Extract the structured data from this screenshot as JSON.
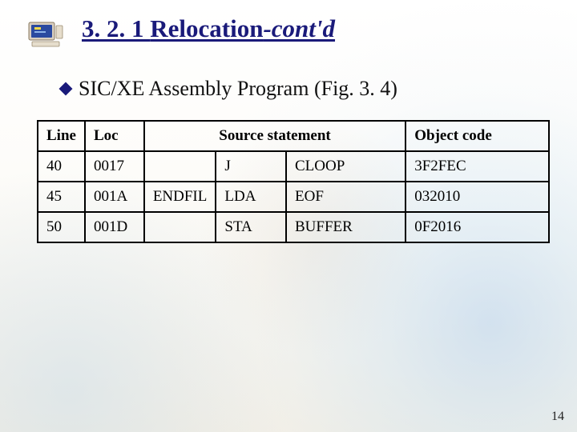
{
  "title": {
    "number": "3. 2. 1",
    "word": "Relocation",
    "contd": "-cont'd"
  },
  "bullet": {
    "text_a": "SIC/XE Assembly Program ",
    "fig": "(Fig. 3. 4)"
  },
  "table": {
    "headers": {
      "line": "Line",
      "loc": "Loc",
      "source": "Source statement",
      "object": "Object code"
    },
    "rows": [
      {
        "line": "40",
        "loc": "0017",
        "label": "",
        "op": "J",
        "arg": "CLOOP",
        "obj": "3F2FEC"
      },
      {
        "line": "45",
        "loc": "001A",
        "label": "ENDFIL",
        "op": "LDA",
        "arg": "EOF",
        "obj": "032010"
      },
      {
        "line": "50",
        "loc": "001D",
        "label": "",
        "op": "STA",
        "arg": "BUFFER",
        "obj": "0F2016"
      }
    ]
  },
  "page_number": "14"
}
